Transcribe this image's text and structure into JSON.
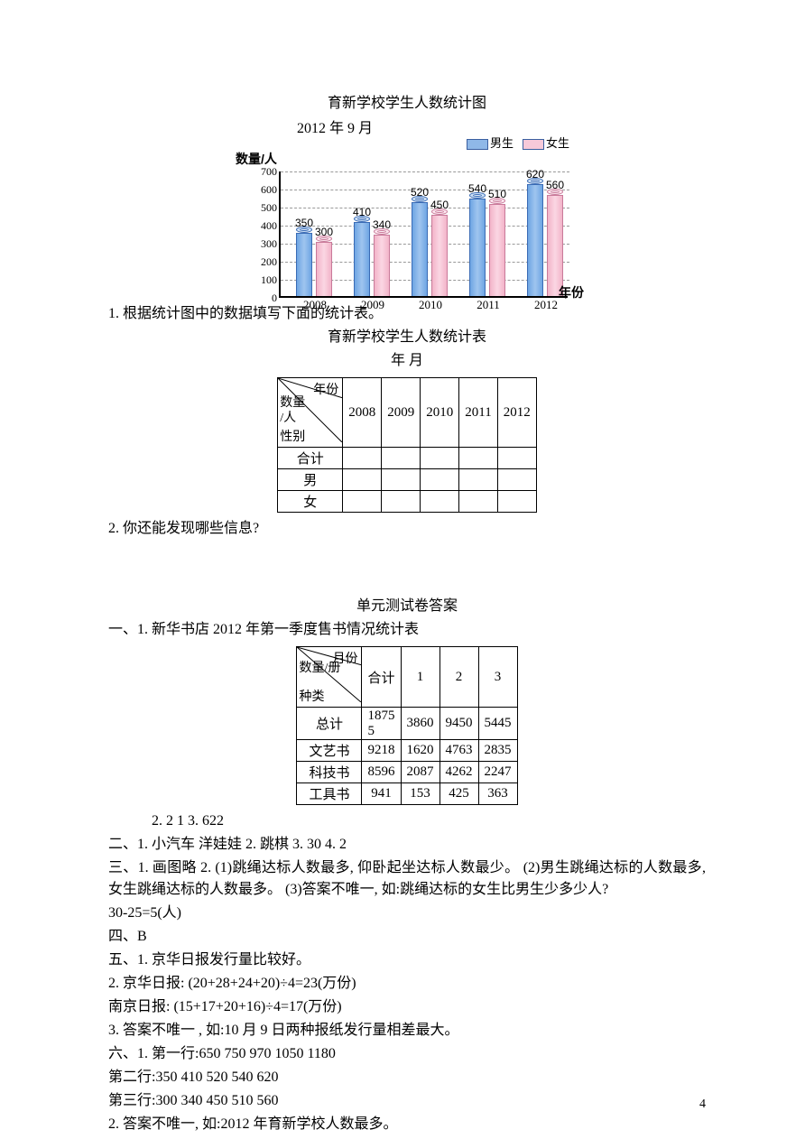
{
  "chart_data": {
    "type": "bar",
    "title": "育新学校学生人数统计图",
    "subtitle": "2012 年 9 月",
    "ylabel": "数量/人",
    "xlabel": "年份",
    "legend": [
      {
        "name": "男生",
        "color": "#8fb8e8"
      },
      {
        "name": "女生",
        "color": "#f7c9d9"
      }
    ],
    "categories": [
      "2008",
      "2009",
      "2010",
      "2011",
      "2012"
    ],
    "series": [
      {
        "name": "男生",
        "values": [
          350,
          410,
          520,
          540,
          620
        ]
      },
      {
        "name": "女生",
        "values": [
          300,
          340,
          450,
          510,
          560
        ]
      }
    ],
    "yticks": [
      0,
      100,
      200,
      300,
      400,
      500,
      600,
      700
    ],
    "ylim": [
      0,
      700
    ]
  },
  "questions": {
    "q1_text": "1. 根据统计图中的数据填写下面的统计表。",
    "q1_table_title": "育新学校学生人数统计表",
    "q1_table_date": "年   月",
    "q1_table": {
      "top_right": "年份",
      "mid_left_a": "数量",
      "mid_left_b": "/人",
      "bot_left": "性别",
      "cols": [
        "2008",
        "2009",
        "2010",
        "2011",
        "2012"
      ],
      "rows": [
        "合计",
        "男",
        "女"
      ]
    },
    "q2_text": "2. 你还能发现哪些信息?"
  },
  "answers": {
    "heading": "单元测试卷答案",
    "a1_intro": "一、1.  新华书店 2012 年第一季度售书情况统计表",
    "a1_table": {
      "top_right": "月份",
      "mid_left": "数量/册",
      "bot_left": "种类",
      "cols": [
        "合计",
        "1",
        "2",
        "3"
      ],
      "rows": [
        {
          "label": "总计",
          "vals": [
            "18755",
            "3860",
            "9450",
            "5445"
          ]
        },
        {
          "label": "文艺书",
          "vals": [
            "9218",
            "1620",
            "4763",
            "2835"
          ]
        },
        {
          "label": "科技书",
          "vals": [
            "8596",
            "2087",
            "4262",
            "2247"
          ]
        },
        {
          "label": "工具书",
          "vals": [
            "941",
            "153",
            "425",
            "363"
          ]
        }
      ]
    },
    "a1_rest": "2. 2   1   3. 622",
    "a2": "二、1. 小汽车   洋娃娃   2. 跳棋   3. 30   4. 2",
    "a3a": "三、1. 画图略   2. (1)跳绳达标人数最多, 仰卧起坐达标人数最少。   (2)男生跳绳达标的人数最多, 女生跳绳达标的人数最多。   (3)答案不唯一, 如:跳绳达标的女生比男生少多少人?",
    "a3b": "30-25=5(人)",
    "a4": "四、B",
    "a5a": "五、1. 京华日报发行量比较好。",
    "a5b": "2. 京华日报: (20+28+24+20)÷4=23(万份)",
    "a5c": "南京日报: (15+17+20+16)÷4=17(万份)",
    "a5d": "3. 答案不唯一 , 如:10 月 9 日两种报纸发行量相差最大。",
    "a6a": "六、1. 第一行:650   750   970   1050   1180",
    "a6b": "第二行:350   410   520   540   620",
    "a6c": "第三行:300   340   450   510   560",
    "a6d": "2. 答案不唯一, 如:2012 年育新学校人数最多。"
  },
  "page_number": "4"
}
